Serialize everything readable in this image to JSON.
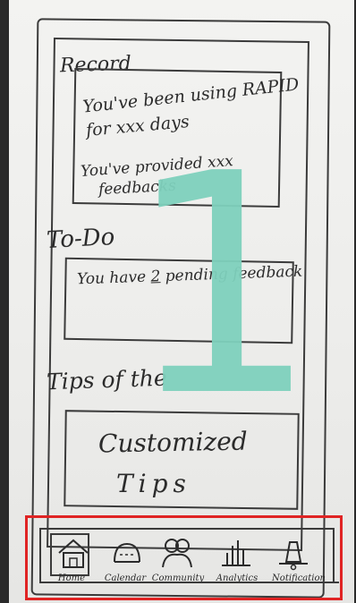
{
  "overlay": {
    "step_number": "1",
    "color": "#7fd1bd"
  },
  "record": {
    "title": "Record",
    "line1": "You've been using RAPID",
    "line2": "for xxx days",
    "line3": "You've provided xxx",
    "line4": "feedbacks"
  },
  "todo": {
    "title": "To-Do",
    "text_before": "You have ",
    "count": "2",
    "text_after": " pending feedback"
  },
  "tips": {
    "title": "Tips of the",
    "line1": "Customized",
    "line2": "Tips"
  },
  "tabbar": {
    "highlight_color": "#e02424",
    "items": [
      {
        "label": "Home",
        "icon": "home-icon",
        "selected": true
      },
      {
        "label": "Calendar",
        "icon": "calendar-icon"
      },
      {
        "label": "Community",
        "icon": "community-icon"
      },
      {
        "label": "Analytics",
        "icon": "analytics-icon"
      },
      {
        "label": "Notification",
        "icon": "notification-icon"
      }
    ]
  }
}
